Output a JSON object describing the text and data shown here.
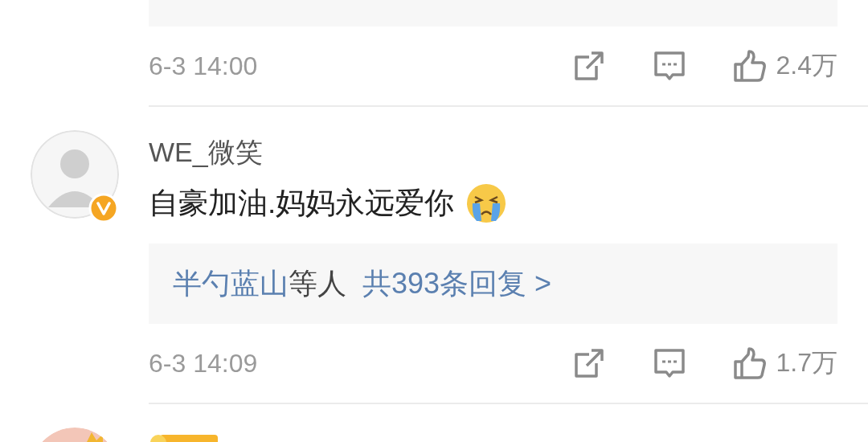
{
  "comments": [
    {
      "kind": "partial",
      "time": "6-3 14:00",
      "likes": "2.4万"
    },
    {
      "kind": "full",
      "name": "WE_微笑",
      "verified": true,
      "text": "自豪加油.妈妈永远爱你",
      "crying_emoji": true,
      "replies": {
        "users": "半勺蓝山",
        "suffix": "等人",
        "total": "共393条回复 >"
      },
      "time": "6-3 14:09",
      "likes": "1.7万"
    },
    {
      "kind": "header",
      "member": true
    }
  ]
}
